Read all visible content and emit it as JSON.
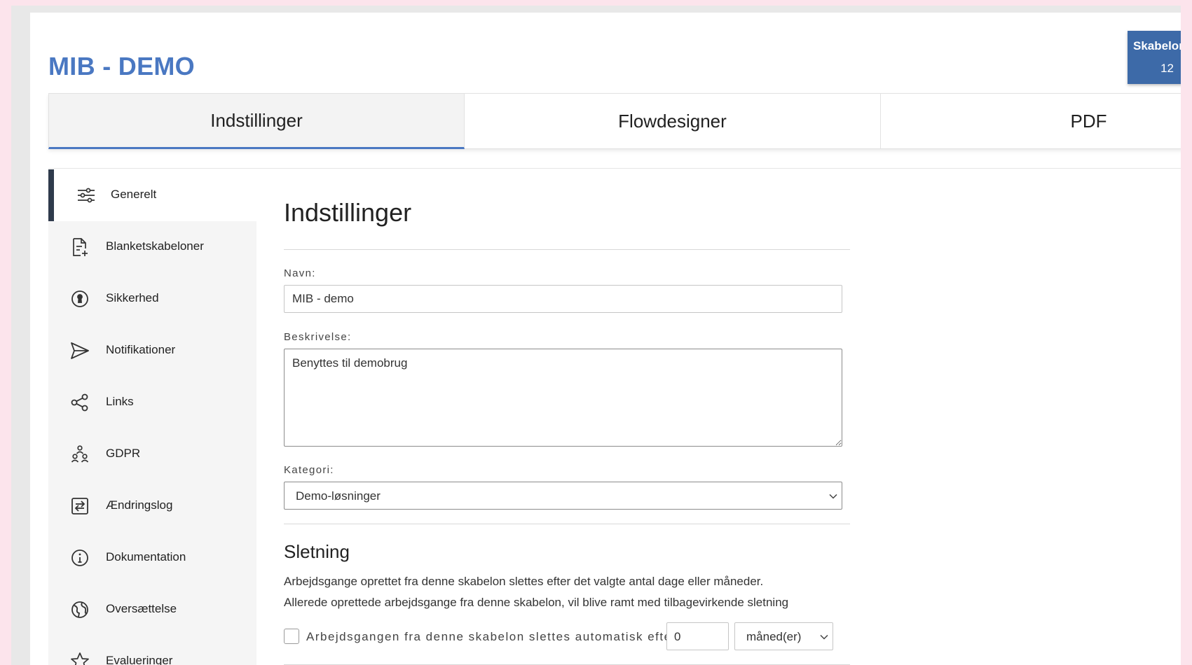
{
  "app": {
    "title": "MIB - DEMO"
  },
  "badge": {
    "label": "Skabelon",
    "count": "12"
  },
  "tabs": [
    {
      "label": "Indstillinger",
      "active": true
    },
    {
      "label": "Flowdesigner",
      "active": false
    },
    {
      "label": "PDF",
      "active": false
    }
  ],
  "sidebar": {
    "items": [
      {
        "label": "Generelt",
        "icon": "sliders-icon",
        "active": true
      },
      {
        "label": "Blanketskabeloner",
        "icon": "document-add-icon"
      },
      {
        "label": "Sikkerhed",
        "icon": "lock-circle-icon"
      },
      {
        "label": "Notifikationer",
        "icon": "send-icon"
      },
      {
        "label": "Links",
        "icon": "share-icon"
      },
      {
        "label": "GDPR",
        "icon": "people-icon"
      },
      {
        "label": "Ændringslog",
        "icon": "swap-icon"
      },
      {
        "label": "Dokumentation",
        "icon": "info-icon"
      },
      {
        "label": "Oversættelse",
        "icon": "globe-icon"
      },
      {
        "label": "Evalueringer",
        "icon": "star-icon"
      }
    ]
  },
  "settings": {
    "heading": "Indstillinger",
    "name_label": "Navn:",
    "name_value": "MIB - demo",
    "description_label": "Beskrivelse:",
    "description_value": "Benyttes til demobrug",
    "category_label": "Kategori:",
    "category_value": "Demo-løsninger"
  },
  "deletion": {
    "heading": "Sletning",
    "line1": "Arbejdsgange oprettet fra denne skabelon slettes efter det valgte antal dage eller måneder.",
    "line2": "Allerede oprettede arbejdsgange fra denne skabelon, vil blive ramt med tilbagevirkende sletning",
    "checkbox_label": "Arbejdsgangen fra denne skabelon slettes automatisk efter",
    "amount": "0",
    "unit": "måned(er)"
  },
  "colors": {
    "accent": "#4a78c2",
    "badge": "#3d6aa8",
    "sidebar_active_bar": "#2f3b4c"
  }
}
